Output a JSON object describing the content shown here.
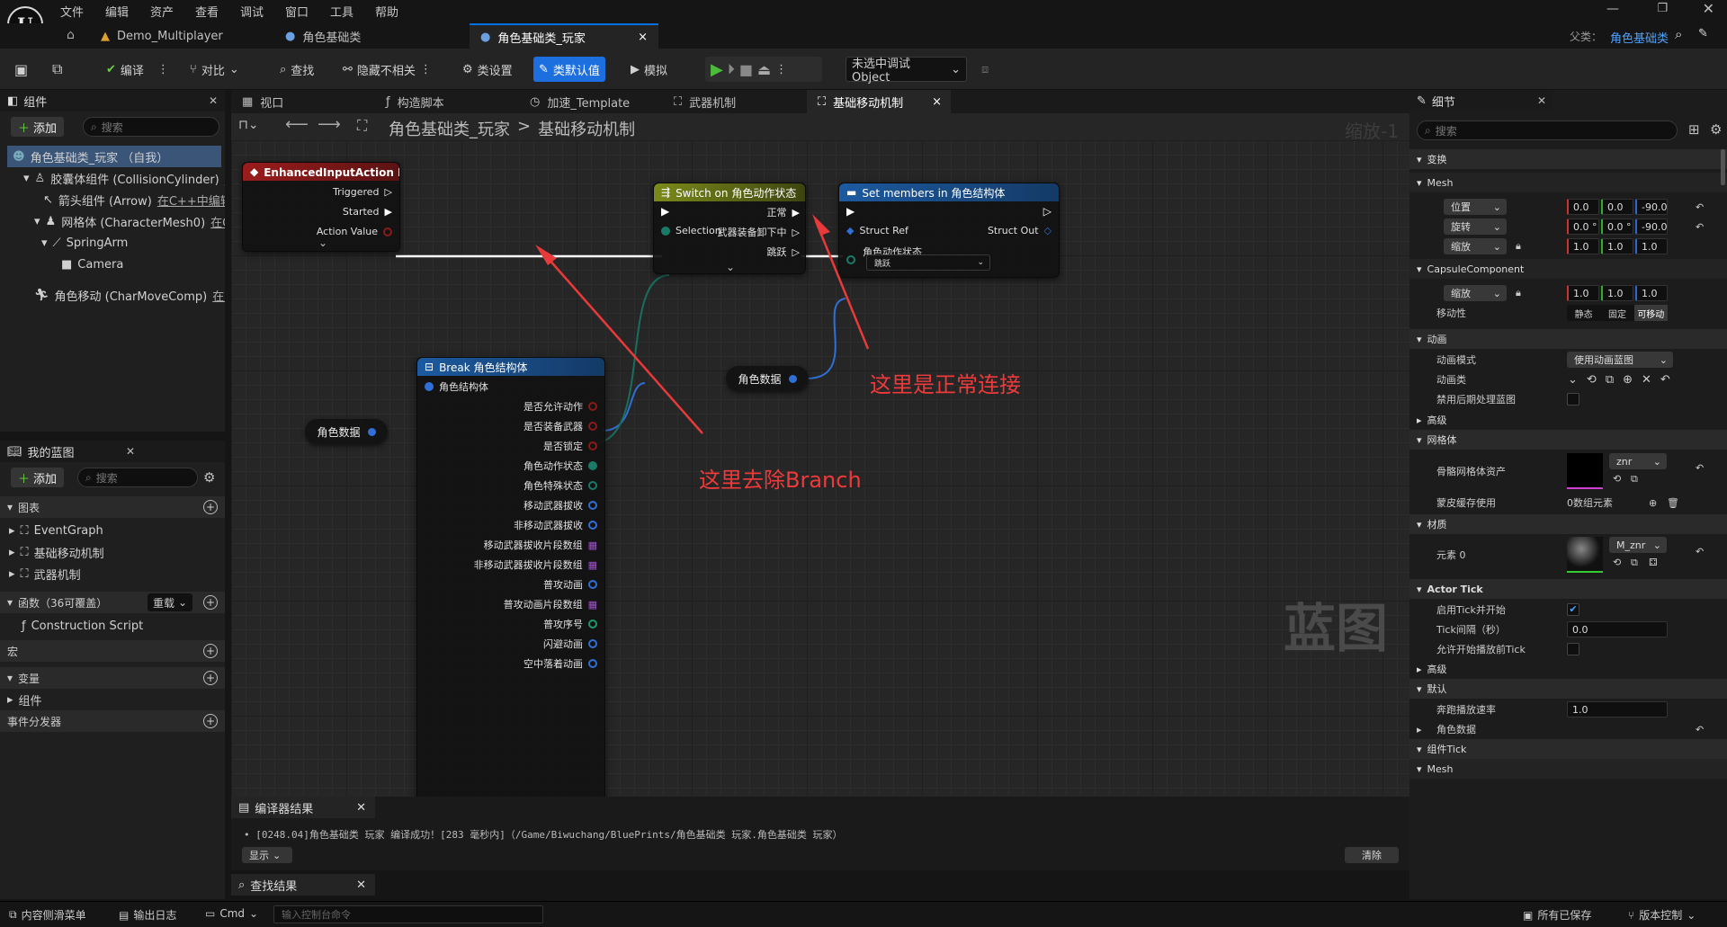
{
  "menu": [
    "文件",
    "编辑",
    "资产",
    "查看",
    "调试",
    "窗口",
    "工具",
    "帮助"
  ],
  "doc_tabs": [
    {
      "label": "Demo_Multiplayer"
    },
    {
      "label": "角色基础类"
    },
    {
      "label": "角色基础类_玩家",
      "close": "×"
    }
  ],
  "parent": {
    "label": "父类：",
    "value": "角色基础类"
  },
  "toolbar": {
    "compile": "编译",
    "diff": "对比",
    "find": "查找",
    "hide_unrelated": "隐藏不相关",
    "class_settings": "类设置",
    "class_defaults": "类默认值",
    "simulate": "模拟",
    "debug_object": "未选中调试Object"
  },
  "components_panel": {
    "title": "组件",
    "add": "添加",
    "search_placeholder": "搜索",
    "items": [
      {
        "label": "角色基础类_玩家 （自我）",
        "extra": ""
      },
      {
        "label": "胶囊体组件 (CollisionCylinder)",
        "extra": "在"
      },
      {
        "label": "箭头组件 (Arrow)",
        "extra": "在C++中编辑"
      },
      {
        "label": "网格体 (CharacterMesh0)",
        "extra": "在C"
      },
      {
        "label": "SpringArm",
        "extra": ""
      },
      {
        "label": "Camera",
        "extra": ""
      },
      {
        "label": "角色移动 (CharMoveComp)",
        "extra": "在C"
      }
    ]
  },
  "my_blueprint": {
    "title": "我的蓝图",
    "add": "添加",
    "search_placeholder": "搜索",
    "graphs_label": "图表",
    "graphs": [
      "EventGraph",
      "基础移动机制",
      "武器机制"
    ],
    "functions_label": "函数（36可覆盖）",
    "override": "重载",
    "construction": "Construction Script",
    "macros": "宏",
    "variables": "变量",
    "components": "组件",
    "dispatchers": "事件分发器"
  },
  "graph_tabs": [
    "视口",
    "构造脚本",
    "加速_Template",
    "武器机制",
    "基础移动机制"
  ],
  "graph_tab_close": "×",
  "breadcrumb": {
    "root": "角色基础类_玩家",
    "sep": ">",
    "current": "基础移动机制"
  },
  "zoom": "缩放-1",
  "watermark": "蓝图",
  "nodes": {
    "input": {
      "title": "EnhancedInputAction IA_跳跃",
      "pins": [
        "Triggered",
        "Started",
        "Action Value"
      ]
    },
    "switch": {
      "title": "Switch on 角色动作状态",
      "in_selection": "Selection",
      "outs": [
        "正常",
        "武器装备卸下中",
        "跳跃"
      ]
    },
    "setm": {
      "title": "Set members in 角色结构体",
      "struct_ref": "Struct Ref",
      "struct_out": "Struct Out",
      "field": "角色动作状态",
      "field_value": "跳跃"
    },
    "break": {
      "title": "Break 角色结构体",
      "in": "角色结构体",
      "outs": [
        "是否允许动作",
        "是否装备武器",
        "是否锁定",
        "角色动作状态",
        "角色特殊状态",
        "移动武器拔收",
        "非移动武器拔收",
        "移动武器拔收片段数组",
        "非移动武器拔收片段数组",
        "普攻动画",
        "普攻动画片段数组",
        "普攻序号",
        "闪避动画",
        "空中落着动画"
      ]
    },
    "var1": "角色数据",
    "var2": "角色数据"
  },
  "annotations": {
    "normal": "这里是正常连接",
    "removed": "这里去除Branch"
  },
  "compiler": {
    "title": "编译器结果",
    "log": "[0248.04]角色基础类_玩家 编译成功！[283 毫秒内]（/Game/Biwuchang/BluePrints/角色基础类_玩家.角色基础类_玩家）",
    "show": "显示",
    "clear": "清除"
  },
  "find_results": {
    "title": "查找结果"
  },
  "details": {
    "title": "细节",
    "search_placeholder": "搜索",
    "transform": "变换",
    "mesh": "Mesh",
    "location": {
      "label": "位置",
      "x": "0.0",
      "y": "0.0",
      "z": "-90.0"
    },
    "rotation": {
      "label": "旋转",
      "x": "0.0 °",
      "y": "0.0 °",
      "z": "-90.0"
    },
    "scale": {
      "label": "缩放",
      "x": "1.0",
      "y": "1.0",
      "z": "1.0"
    },
    "capsule": "CapsuleComponent",
    "cap_scale": {
      "label": "缩放",
      "x": "1.0",
      "y": "1.0",
      "z": "1.0"
    },
    "mobility": {
      "label": "移动性",
      "options": [
        "静态",
        "固定",
        "可移动"
      ]
    },
    "animation": "动画",
    "anim_mode": {
      "label": "动画模式",
      "value": "使用动画蓝图"
    },
    "anim_class": "动画类",
    "disable_pp": "禁用后期处理蓝图",
    "advanced": "高级",
    "mesh_sec": "网格体",
    "skel_mesh": {
      "label": "骨骼网格体资产",
      "value": "znr"
    },
    "skin_cache": {
      "label": "蒙皮缓存使用",
      "value": "0数组元素"
    },
    "materials": "材质",
    "element0": {
      "label": "元素 0",
      "value": "M_znr"
    },
    "actor_tick": "Actor Tick",
    "start_tick": "启用Tick并开始",
    "tick_interval": {
      "label": "Tick间隔（秒）",
      "value": "0.0"
    },
    "tick_before_begin": "允许开始播放前Tick",
    "advanced2": "高级",
    "defaults": "默认",
    "run_speed": {
      "label": "奔跑播放速率",
      "value": "1.0"
    },
    "char_data": "角色数据",
    "comp_tick": "组件Tick",
    "mesh2": "Mesh"
  },
  "statusbar": {
    "content_drawer": "内容侧滑菜单",
    "output_log": "输出日志",
    "cmd": "Cmd",
    "cmd_placeholder": "输入控制台命令",
    "all_saved": "所有已保存",
    "source_control": "版本控制"
  },
  "colors": {
    "accent": "#1d6fe0",
    "input_header": "#8b1a1a",
    "switch_header": "#6b7a18",
    "setm_header": "#1a4f8a",
    "break_header": "#1a4f8a",
    "annotation": "#ee3a3a"
  }
}
